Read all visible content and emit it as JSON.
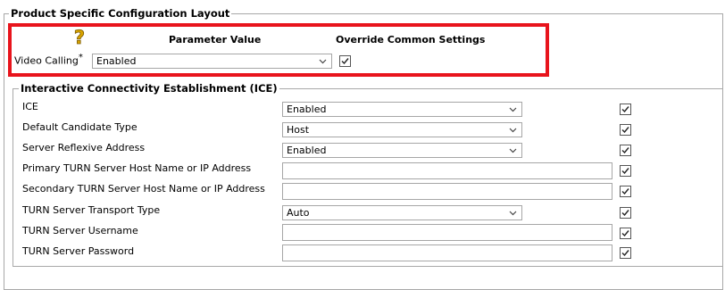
{
  "outer_fieldset": {
    "legend": "Product Specific Configuration Layout"
  },
  "product": {
    "help_icon": "question-mark-icon",
    "header_param": "Parameter Value",
    "header_override": "Override Common Settings",
    "video_calling": {
      "label": "Video Calling",
      "required_marker": "*",
      "value": "Enabled",
      "override": true
    }
  },
  "ice": {
    "legend": "Interactive Connectivity Establishment (ICE)",
    "rows": [
      {
        "label": "ICE",
        "type": "select",
        "value": "Enabled",
        "override": true
      },
      {
        "label": "Default Candidate Type",
        "type": "select",
        "value": "Host",
        "override": true
      },
      {
        "label": "Server Reflexive Address",
        "type": "select",
        "value": "Enabled",
        "override": true
      },
      {
        "label": "Primary TURN Server Host Name or IP Address",
        "type": "text",
        "value": "",
        "override": true
      },
      {
        "label": "Secondary TURN Server Host Name or IP Address",
        "type": "text",
        "value": "",
        "override": true
      },
      {
        "label": "TURN Server Transport Type",
        "type": "select",
        "value": "Auto",
        "override": true
      },
      {
        "label": "TURN Server Username",
        "type": "text",
        "value": "",
        "override": true
      },
      {
        "label": "TURN Server Password",
        "type": "text",
        "value": "",
        "override": true
      }
    ]
  },
  "colors": {
    "highlight_border": "#e8141c",
    "fieldset_border": "#a8a8a8",
    "help_icon": "#d9a400"
  }
}
